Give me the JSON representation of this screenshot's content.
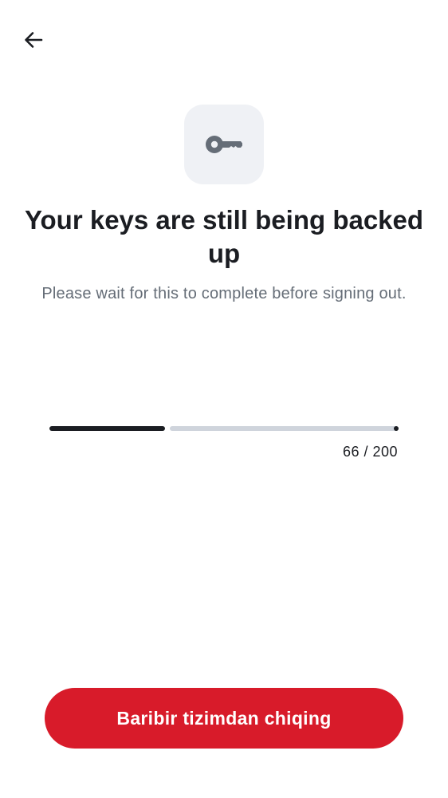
{
  "header": {
    "back_icon": "arrow-back-icon"
  },
  "hero": {
    "icon": "key-icon",
    "title": "Your keys are still being backed up",
    "subtitle": "Please wait for this to complete before signing out."
  },
  "progress": {
    "current": 66,
    "total": 200,
    "label": "66 / 200"
  },
  "actions": {
    "sign_out_label": "Baribir tizimdan chiqing"
  },
  "colors": {
    "accent_danger": "#d81b2a",
    "text_primary": "#1b1d22",
    "text_secondary": "#656d77",
    "icon_tile_bg": "#eff1f5",
    "progress_track": "#cfd4dc"
  }
}
